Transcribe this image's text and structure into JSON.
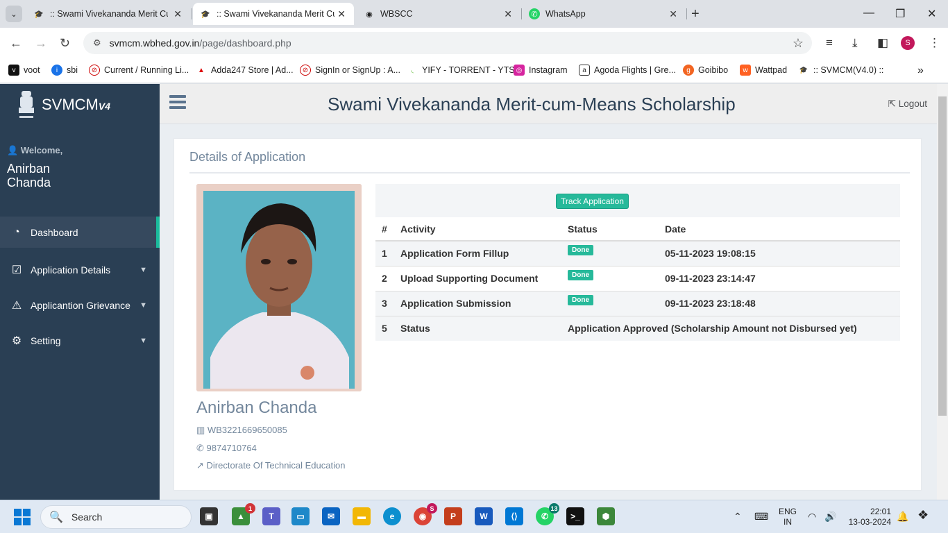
{
  "browser": {
    "tabs": [
      {
        "label": ":: Swami Vivekananda Merit Cum",
        "active": false
      },
      {
        "label": ":: Swami Vivekananda Merit Cum",
        "active": true
      },
      {
        "label": "WBSCC",
        "active": false
      },
      {
        "label": "WhatsApp",
        "active": false
      }
    ],
    "url_host": "svmcm.wbhed.gov.in",
    "url_path": "/page/dashboard.php",
    "profile_initial": "S",
    "bookmarks": [
      {
        "label": "voot",
        "icon": "voot-icon"
      },
      {
        "label": "sbi",
        "icon": "sbi-icon"
      },
      {
        "label": "Current / Running Li...",
        "icon": "block-icon"
      },
      {
        "label": "Adda247 Store | Ad...",
        "icon": "adda-icon"
      },
      {
        "label": "SignIn or SignUp : A...",
        "icon": "block-icon"
      },
      {
        "label": "YIFY - TORRENT - YTS",
        "icon": "yify-icon"
      },
      {
        "label": "Instagram",
        "icon": "instagram-icon"
      },
      {
        "label": "Agoda Flights | Gre...",
        "icon": "agoda-icon"
      },
      {
        "label": "Goibibo",
        "icon": "goibibo-icon"
      },
      {
        "label": "Wattpad",
        "icon": "wattpad-icon"
      },
      {
        "label": ":: SVMCM(V4.0) ::",
        "icon": "svmcm-icon"
      }
    ]
  },
  "sidebar": {
    "brand": "SVMCM",
    "brand_version": "V4",
    "welcome": "Welcome,",
    "user_name": "Anirban Chanda",
    "menu": [
      {
        "label": "Dashboard",
        "icon": "dashboard-icon",
        "active": true,
        "has_children": false
      },
      {
        "label": "Application Details",
        "icon": "checkbox-icon",
        "active": false,
        "has_children": true
      },
      {
        "label": "Applicantion Grievance",
        "icon": "warning-icon",
        "active": false,
        "has_children": true
      },
      {
        "label": "Setting",
        "icon": "gear-icon",
        "active": false,
        "has_children": true
      }
    ]
  },
  "header": {
    "title": "Swami Vivekananda Merit-cum-Means Scholarship",
    "logout": "Logout"
  },
  "application": {
    "panel_title": "Details of Application",
    "student_name": "Anirban Chanda",
    "application_id": "WB3221669650085",
    "phone": "9874710764",
    "directorate": "Directorate Of Technical Education",
    "track_button": "Track Application",
    "table_headers": [
      "#",
      "Activity",
      "Status",
      "Date"
    ],
    "rows": [
      {
        "num": "1",
        "activity": "Application Form Fillup",
        "status": "Done",
        "date": "05-11-2023 19:08:15"
      },
      {
        "num": "2",
        "activity": "Upload Supporting Document",
        "status": "Done",
        "date": "09-11-2023 23:14:47"
      },
      {
        "num": "3",
        "activity": "Application Submission",
        "status": "Done",
        "date": "09-11-2023 23:18:48"
      }
    ],
    "final_row": {
      "num": "5",
      "activity": "Status",
      "status_text": "Application Approved (Scholarship Amount not Disbursed yet)"
    }
  },
  "taskbar": {
    "search_placeholder": "Search",
    "badges": {
      "app1": "1",
      "chrome": "S",
      "whatsapp": "13"
    },
    "lang_line1": "ENG",
    "lang_line2": "IN",
    "time": "22:01",
    "date": "13-03-2024"
  },
  "colors": {
    "sidebar_bg": "#2a3f54",
    "accent": "#26b99a",
    "text_muted": "#73879c"
  }
}
